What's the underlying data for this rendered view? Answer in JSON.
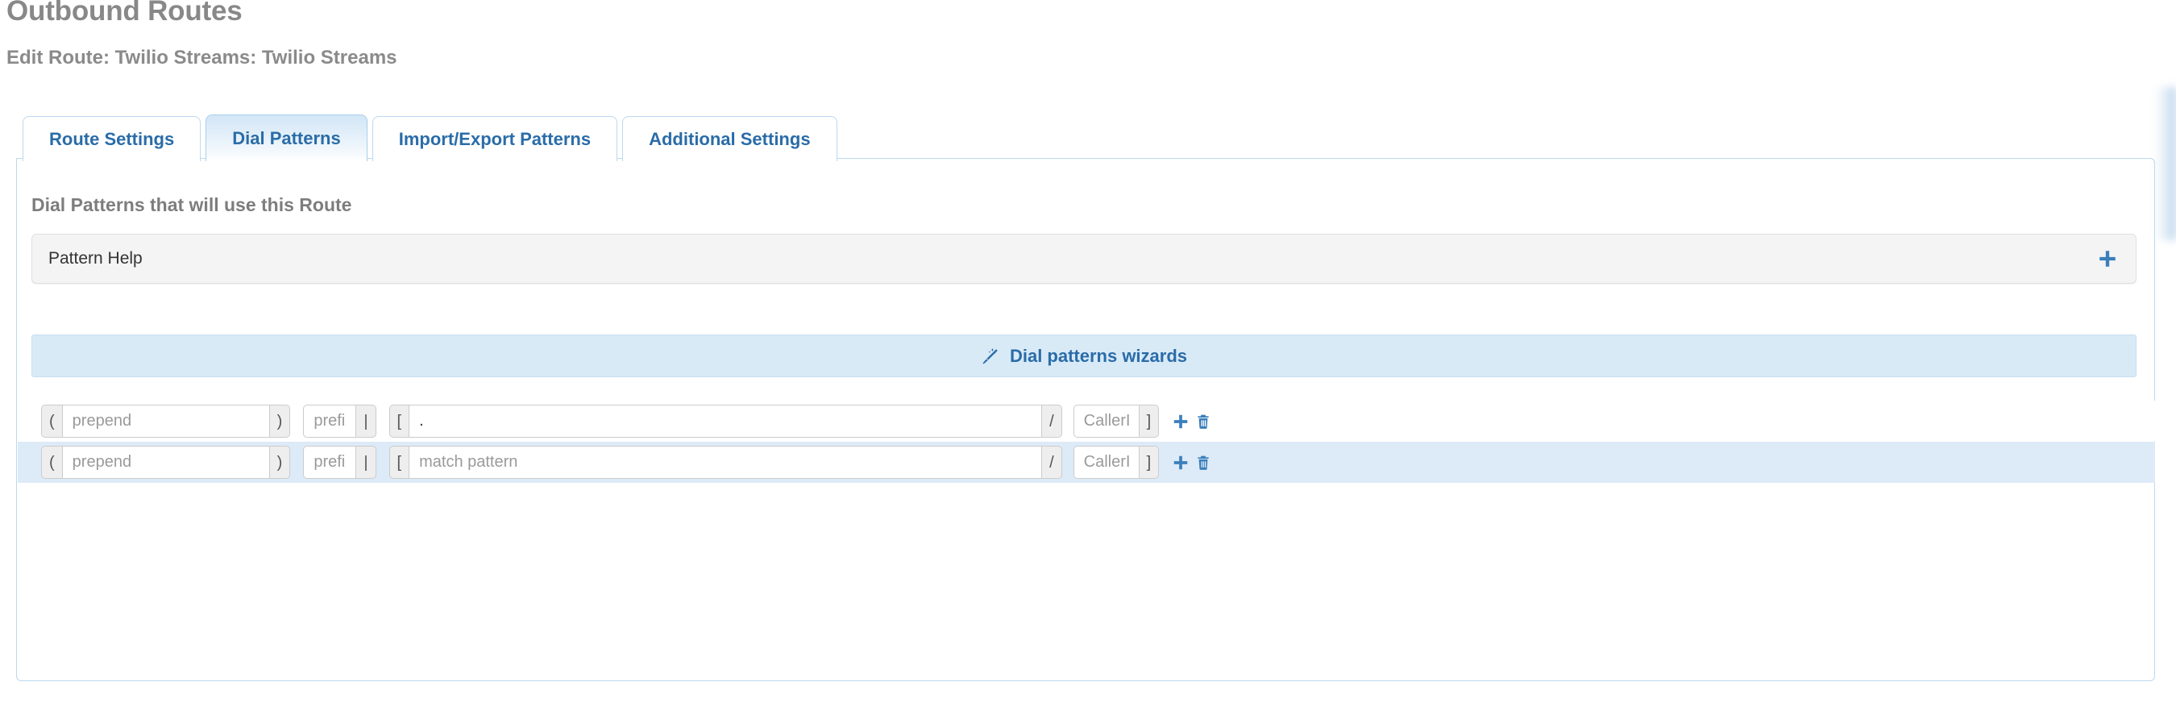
{
  "header": {
    "title": "Outbound Routes",
    "subtitle": "Edit Route: Twilio Streams: Twilio Streams"
  },
  "tabs": [
    {
      "label": "Route Settings",
      "active": false
    },
    {
      "label": "Dial Patterns",
      "active": true
    },
    {
      "label": "Import/Export Patterns",
      "active": false
    },
    {
      "label": "Additional Settings",
      "active": false
    }
  ],
  "main": {
    "section_heading": "Dial Patterns that will use this Route",
    "help_panel": {
      "label": "Pattern Help",
      "expand_icon": "plus-icon"
    },
    "wizard_bar": {
      "label": "Dial patterns wizards",
      "icon": "magic-wand-icon"
    },
    "pattern_rows": [
      {
        "open_paren": "(",
        "prepend_placeholder": "prepend",
        "prepend_value": "",
        "close_paren": ")",
        "prefix_placeholder": "prefix",
        "prefix_value": "",
        "pipe": "|",
        "open_bracket": "[",
        "match_placeholder": "match pattern",
        "match_value": ".",
        "slash": "/",
        "callerid_placeholder": "CallerID",
        "callerid_value": "",
        "close_bracket": "]",
        "add_icon": "plus-icon",
        "delete_icon": "trash-icon",
        "striped": false
      },
      {
        "open_paren": "(",
        "prepend_placeholder": "prepend",
        "prepend_value": "",
        "close_paren": ")",
        "prefix_placeholder": "prefix",
        "prefix_value": "",
        "pipe": "|",
        "open_bracket": "[",
        "match_placeholder": "match pattern",
        "match_value": "",
        "slash": "/",
        "callerid_placeholder": "CallerID",
        "callerid_value": "",
        "close_bracket": "]",
        "add_icon": "plus-icon",
        "delete_icon": "trash-icon",
        "striped": true
      }
    ]
  },
  "colors": {
    "link_blue": "#2a6ca8",
    "icon_blue": "#3a7fbb",
    "tab_border": "#bcd9ef",
    "stripe_blue": "#ddeaf7",
    "wizard_bg": "#d9eaf7",
    "heading_gray": "#8a8a8a"
  }
}
